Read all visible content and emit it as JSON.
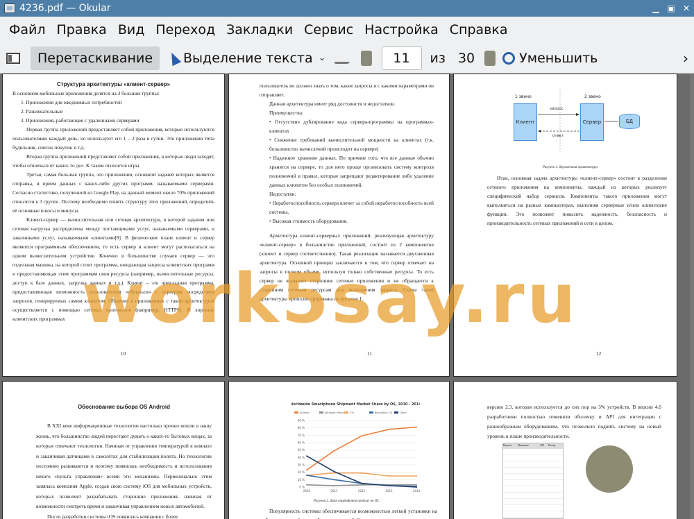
{
  "window": {
    "title": "4236.pdf — Okular"
  },
  "menu": [
    "Файл",
    "Правка",
    "Вид",
    "Переход",
    "Закладки",
    "Сервис",
    "Настройка",
    "Справка"
  ],
  "toolbar": {
    "drag_label": "Перетаскивание",
    "select_label": "Выделение текста",
    "page_value": "11",
    "of_label": "из",
    "total_pages": "30",
    "zoom_label": "Уменьшить"
  },
  "watermark": "work5say.ru",
  "pages": {
    "p10": {
      "heading": "Структура архитектуры «клиент-сервер»",
      "intro": "В основном мобильные приложения делятся на 3 большие группы:",
      "list": [
        "Приложения для ежедневных потребностей",
        "Развлекательные",
        "Приложения, работающие с удаленными серверами"
      ],
      "paras": [
        "Первая группа приложений предоставляет собой приложения, которые используются пользователями каждый день, но используют его 1 – 2 раза в сутки. Это приложения типа будильник, список покупок и т.д.",
        "Вторая группа приложений представляет собой приложения, в которые люди заходят, чтобы отвлечься от каких-то дел. К таким относятся игры.",
        "Третья, самая большая группа, это приложения, основной задачей которых является отправка, и прием данных с каких-либо других программ, называемыми серверами. Согласно статистике, полученной из Google Play, на данный момент около 70% приложений относятся к 3 группе. Поэтому необходимо понять структуру этих приложений, определить её основные плюсы и минусы.",
        "Клиент-сервер — вычислительная или сетевая архитектура, в которой задания или сетевая нагрузка распределены между поставщиками услуг, называемыми серверами, и заказчиками услуг, называемыми клиентами[8]. В физическом плане клиент и сервер являются программным обеспечением, то есть сервер и клиент могут располагаться на одном вычислительном устройстве. Конечно в большинстве случаев сервер — это отдельная машина, на которой стоит программа, ожидающая запросы клиентских программ и предоставляющая этим программам свои ресурсы (например, вычислительные ресурсы, доступ к базе данных, загрузка данных и т.д.). Клиент – это прикладная программа, предоставляющая возможность пользователям «общаться» с сервером посредством запросов, генерируемых самим клиентом. Общение в приложениях с такой архитектурой осуществляется с помощью сетевых протоколов (например, HTTPS). В хороших клиентских программах"
      ],
      "number": "10"
    },
    "p11": {
      "lead": "пользователь не должен знать о том, какие запросы и с какими параметрами он отправляет.",
      "adv_intro": "Данная архитектура имеет ряд достоинств и недостатков.",
      "adv_title": "Преимущества:",
      "adv": [
        "Отсутствие дублирование кода сервера-программы на программах-клиентах",
        "Снижение требований вычислительной мощности на клиентах (т.к. большинство вычислений происходит на сервере)",
        "Надежное хранение данных. По причине того, что все данные обычно хранятся на сервере, то для него проще организовать систему контроля полномочий и правил, которые запрещают редактирование либо удаление данных клиентом без особых полномочий."
      ],
      "dis_title": "Недостатки:",
      "dis": [
        "Неработоспособность сервера влечет за собой неработоспособность всей системы.",
        "Высокая стоимость оборудования."
      ],
      "para": "Архитектура клиент-серверных приложений, реализующая архитектуру «клиент-сервер» в большинстве приложений, состоит из 2 компонентов (клиент и сервер соответственно). Такая реализация называется двухзвенная архитектура. Основной принцип заключается в том, что сервер отвечает на запросы в полном объеме, используя только собственные ресурсы. То есть сервер не вызывает сторонние сетевые приложения и не обращается к сторонним сетевым ресурсам для выполнения запроса. Схема такой архитектуры проиллюстрирована на рисунке 1.",
      "number": "11"
    },
    "p12": {
      "tier1": "1 звено",
      "tier2": "2 звено",
      "client": "Клиент",
      "server": "Сервер",
      "db": "БД",
      "request": "запрос",
      "response": "ответ",
      "caption": "Рисунок 1. Двухзвенная архитектура",
      "para": "Итак, основная задача архитектуры «клиент-сервер» состоит в разделении сетевого приложения на компоненты, каждый из которых реализует специфический набор сервисов. Компоненты такого приложения могут выполняться на разных компьютерах, выполняя серверные и/или клиентские функции. Это позволяет повысить надежность, безопасность и производительность сетевых приложений и сети в целом.",
      "number": "12"
    },
    "p13": {
      "heading": "Обоснование выбора OS Android",
      "paras": [
        "В XXI веке информационные технологии настолько прочно вошли в нашу жизнь, что большинство людей перестают думать о каких-то бытовых вещах, за которые отвечают технологии. Начиная от управления температурой в комнате и заканчивая датчиками в самолётах для стабилизации полета. Но технологии постоянно развиваются и поэтому появилась необходимость и использования некого «пульта управления» всеми эти механизмы. Первоначально этим занялась компания Apple, создав свою систему iOS для мобильных устройств, которых позволяет разрабатывать сторонние приложения, начиная от возможности смотреть время и заканчивая управлением новых автомобилей.",
        "После разработки системы iOS появилась компания с более"
      ]
    },
    "p14": {
      "caption": "Рисунок 2. Доля смартфонов продаж по ОС",
      "para": "Популярность системы обеспечивается возможностью легкой установки на мобильные устройства любых приложений. Система позволяет подстроить"
    },
    "p15": {
      "para": "версию 2.3, которая используется до сих пор на 3% устройств. В версии 4.0 разработчики полностью поменяли оболочку и API для интеграции с разнообразным оборудованием, что позволило поднять систему на новый уровень в плане производительности.",
      "table_headers": [
        "Версия",
        "Название",
        "API",
        "Распр."
      ]
    }
  },
  "chart_data": {
    "type": "line",
    "title": "Worldwide Smartphone Shipment Market Share by OS, 2010 - 2014",
    "categories": [
      "2010",
      "2011",
      "2012",
      "2013",
      "2014"
    ],
    "ylim": [
      0,
      90
    ],
    "yticks": [
      "0 %",
      "10 %",
      "20 %",
      "30 %",
      "40 %",
      "50 %",
      "60 %",
      "70 %",
      "80 %",
      "90 %"
    ],
    "series": [
      {
        "name": "Android",
        "color": "#f07f3c",
        "values": [
          23,
          49,
          69,
          78,
          81
        ]
      },
      {
        "name": "Windows Phone",
        "color": "#8f8f8f",
        "values": [
          3,
          2,
          3,
          3,
          3
        ]
      },
      {
        "name": "iOS",
        "color": "#f4a25c",
        "values": [
          16,
          19,
          19,
          15,
          15
        ]
      },
      {
        "name": "BlackBerry OS",
        "color": "#3a6ea5",
        "values": [
          16,
          10,
          5,
          2,
          1
        ]
      },
      {
        "name": "Other",
        "color": "#1f3f6e",
        "values": [
          42,
          21,
          5,
          2,
          0
        ]
      }
    ]
  }
}
